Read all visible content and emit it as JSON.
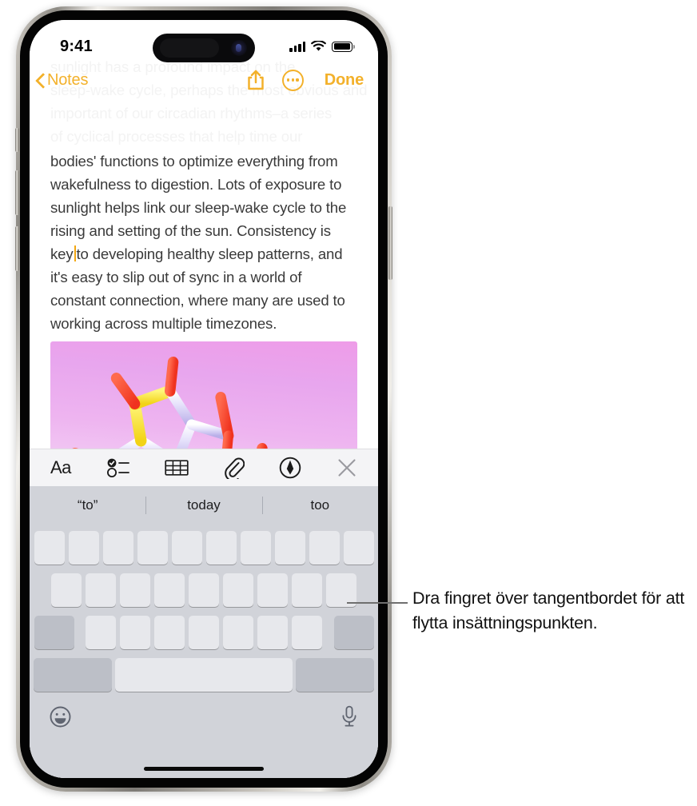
{
  "status_bar": {
    "time": "9:41",
    "icons": [
      "cellular-signal-icon",
      "wifi-icon",
      "battery-icon"
    ]
  },
  "nav_bar": {
    "back_label": "Notes",
    "back_icon": "chevron-left-icon",
    "share_icon": "share-icon",
    "more_icon": "more-ellipsis-circle-icon",
    "done_label": "Done",
    "accent_color": "#F3B12B"
  },
  "note": {
    "ghost_lines": [
      "sunlight has a profound impact on the",
      "sleep-wake cycle, perhaps the most obvious and",
      "important of our circadian rhythms–a series",
      "of cyclical processes that help time our"
    ],
    "body_before_caret": "bodies' functions to optimize everything from wakefulness to digestion. Lots of exposure to sunlight helps link our sleep-wake cycle to the rising and setting of the sun. Consistency is key",
    "body_after_caret": "to developing healthy sleep patterns, and it's easy to slip out of sync in a world of constant connection, where many are used to working across multiple timezones.",
    "caret_color": "#F3A712",
    "attachment": {
      "name": "molecule-image",
      "background_start": "#ee9ce8",
      "background_end": "#f7e3f8"
    }
  },
  "note_toolbar": {
    "items": [
      {
        "name": "format-aa-button",
        "label": "Aa",
        "icon": "text-format-icon"
      },
      {
        "name": "checklist-button",
        "label": "",
        "icon": "checklist-icon"
      },
      {
        "name": "table-button",
        "label": "",
        "icon": "table-icon"
      },
      {
        "name": "attachment-button",
        "label": "",
        "icon": "paperclip-icon"
      },
      {
        "name": "markup-button",
        "label": "",
        "icon": "markup-pen-circle-icon"
      },
      {
        "name": "close-button",
        "label": "",
        "icon": "close-x-icon"
      }
    ]
  },
  "keyboard": {
    "predictions": [
      "“to”",
      "today",
      "too"
    ],
    "rows": [
      {
        "name": "row-1",
        "key_count": 10
      },
      {
        "name": "row-2",
        "key_count": 9
      },
      {
        "name": "row-3",
        "key_count": 7
      }
    ],
    "shift_key": "shift-key",
    "delete_key": "delete-key",
    "number_key": "numbers-123-key",
    "space_key": "space-key",
    "return_key": "return-key",
    "emoji_icon": "emoji-smiley-icon",
    "dictation_icon": "microphone-icon",
    "state": "trackpad-mode-blank-keys",
    "background_color": "#D1D3D9",
    "key_color": "#E7E8EC",
    "modifier_key_color": "#BCBFC7"
  },
  "callout": {
    "text": "Dra fingret över tangentbordet för att flytta insättningspunkten."
  }
}
